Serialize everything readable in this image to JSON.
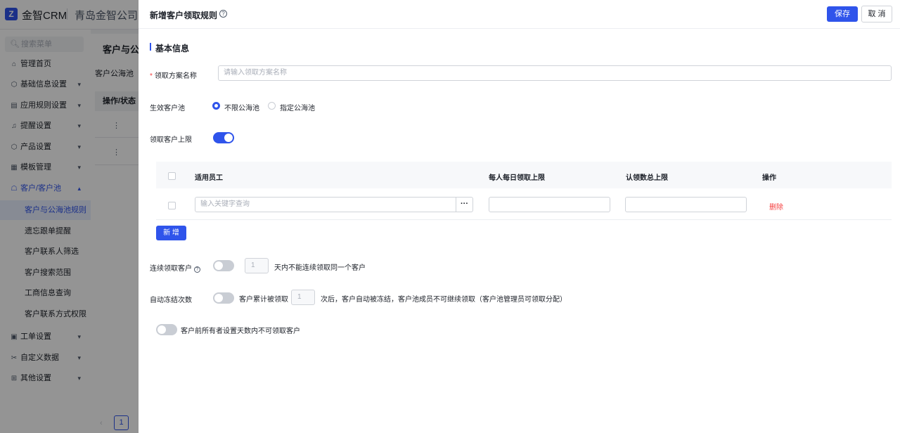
{
  "app": {
    "logo_glyph": "Z",
    "brand": "金智CRM",
    "company": "青岛金智公司"
  },
  "sidebar": {
    "search_placeholder": "搜索菜单",
    "items": [
      {
        "label": "管理首页",
        "icon": "home-icon"
      },
      {
        "label": "基础信息设置",
        "icon": "cube-icon"
      },
      {
        "label": "应用规则设置",
        "icon": "file-icon"
      },
      {
        "label": "提醒设置",
        "icon": "bell-icon"
      },
      {
        "label": "产品设置",
        "icon": "cube-icon"
      },
      {
        "label": "模板管理",
        "icon": "template-icon"
      },
      {
        "label": "客户/客户池",
        "icon": "users-icon"
      }
    ],
    "sub_items": [
      {
        "label": "客户与公海池规则"
      },
      {
        "label": "遗忘跟单提醒"
      },
      {
        "label": "客户联系人筛选"
      },
      {
        "label": "客户搜索范围"
      },
      {
        "label": "工商信息查询"
      },
      {
        "label": "客户联系方式权限"
      }
    ],
    "bottom_items": [
      {
        "label": "工单设置",
        "icon": "order-icon"
      },
      {
        "label": "自定义数据",
        "icon": "custom-data-icon"
      },
      {
        "label": "其他设置",
        "icon": "grid-icon"
      }
    ]
  },
  "background_page": {
    "title": "客户与公海",
    "tab": "客户公海池",
    "column_header": "操作/状态",
    "row_menu": "⋮",
    "pagination": {
      "current_page": "1"
    }
  },
  "drawer": {
    "title": "新增客户领取规则",
    "save_label": "保存",
    "cancel_label": "取 消",
    "section_title": "基本信息",
    "plan_name": {
      "label": "领取方案名称",
      "placeholder": "请输入领取方案名称"
    },
    "pool": {
      "label": "生效客户池",
      "options": [
        "不限公海池",
        "指定公海池"
      ],
      "selected": "不限公海池"
    },
    "limit": {
      "label": "领取客户上限",
      "enabled": true
    },
    "table": {
      "headers": [
        "适用员工",
        "每人每日领取上限",
        "认领数总上限",
        "操作"
      ],
      "row": {
        "employee_placeholder": "输入关键字查询",
        "more": "···",
        "daily_limit": "",
        "total_limit": "",
        "action": "删除"
      }
    },
    "add_label": "新 增",
    "continuous": {
      "label": "连续领取客户",
      "enabled": false,
      "value": "1",
      "suffix": "天内不能连续领取同一个客户"
    },
    "auto_freeze": {
      "label": "自动冻结次数",
      "enabled": false,
      "prefix": "客户累计被领取",
      "value": "1",
      "suffix": "次后，客户自动被冻结，客户池成员不可继续领取（客户池管理员可领取分配）"
    },
    "prev_owner": {
      "enabled": false,
      "label": "客户前所有者设置天数内不可领取客户"
    }
  },
  "colors": {
    "primary": "#2f54eb",
    "danger": "#f53f3f",
    "mask": "rgba(0,0,0,0.42)"
  }
}
